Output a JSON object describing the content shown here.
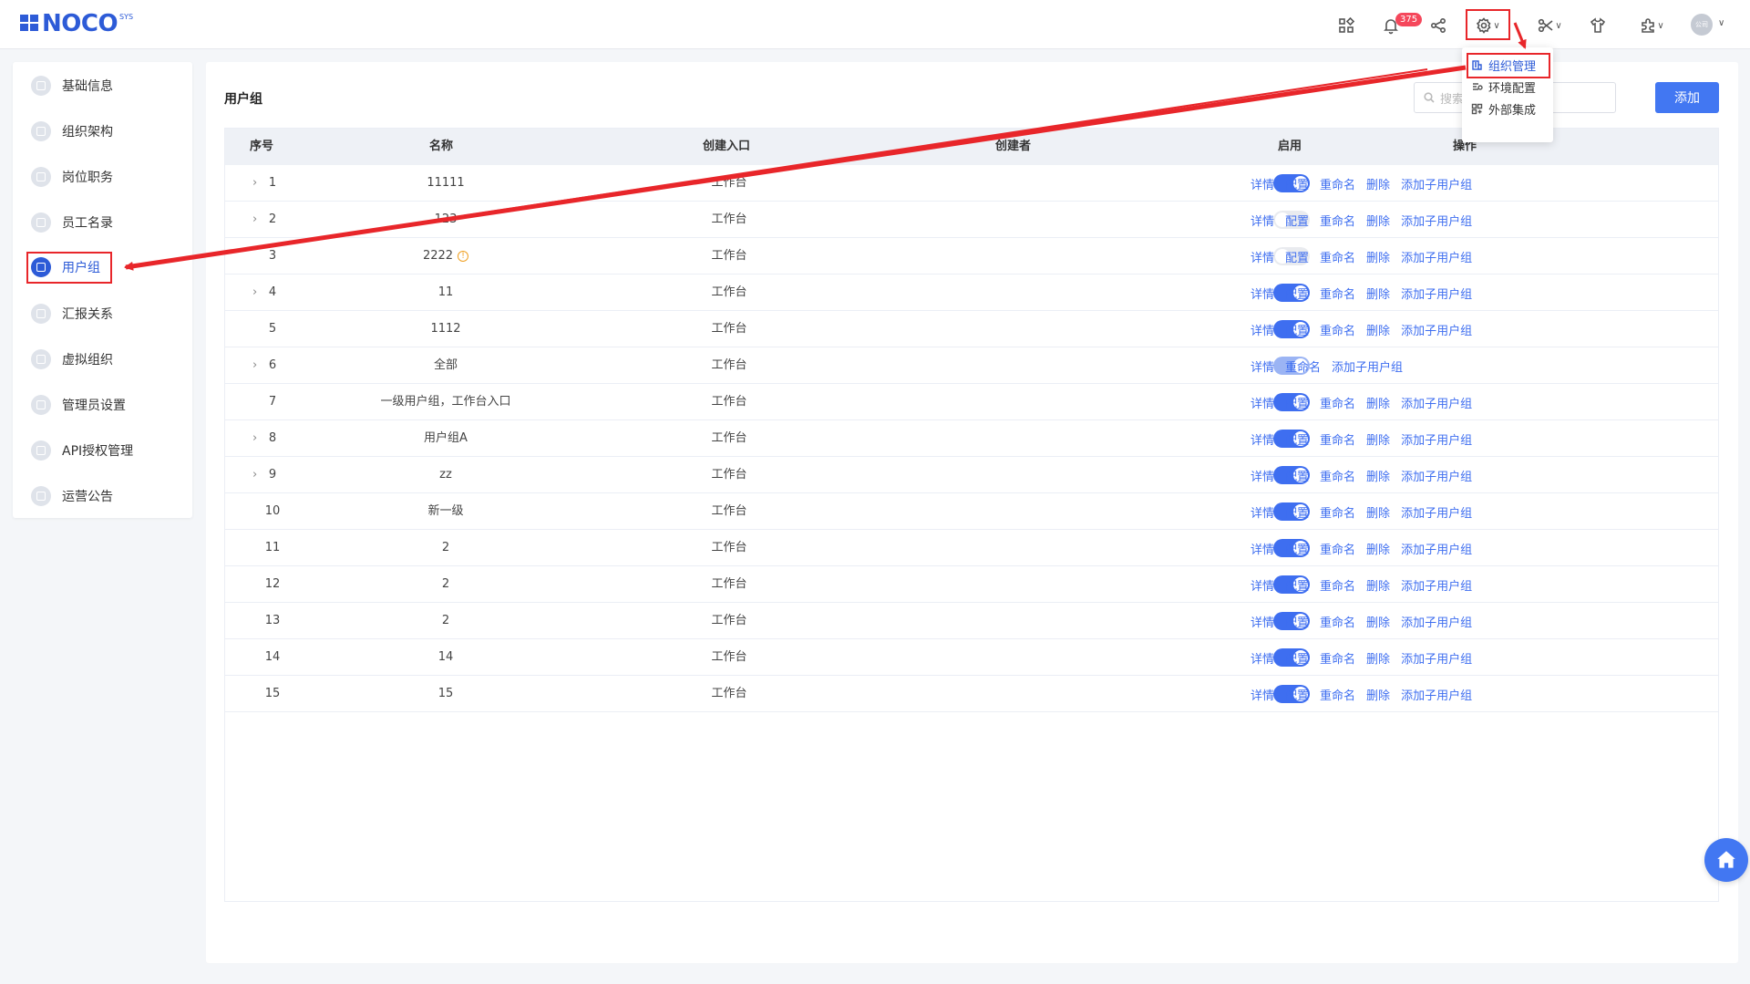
{
  "app": {
    "logo_text": "NOCO",
    "logo_sup": "SYS"
  },
  "header": {
    "notification_count": "375",
    "avatar_text": "公司"
  },
  "settings_menu": {
    "items": [
      {
        "label": "组织管理",
        "icon": "org-icon",
        "active": true
      },
      {
        "label": "环境配置",
        "icon": "env-icon",
        "active": false
      },
      {
        "label": "外部集成",
        "icon": "integration-icon",
        "active": false
      }
    ]
  },
  "sidebar": {
    "items": [
      {
        "label": "基础信息"
      },
      {
        "label": "组织架构"
      },
      {
        "label": "岗位职务"
      },
      {
        "label": "员工名录"
      },
      {
        "label": "用户组",
        "active": true
      },
      {
        "label": "汇报关系"
      },
      {
        "label": "虚拟组织"
      },
      {
        "label": "管理员设置"
      },
      {
        "label": "API授权管理"
      },
      {
        "label": "运营公告"
      }
    ]
  },
  "main": {
    "title": "用户组",
    "search_placeholder": "搜索",
    "add_label": "添加",
    "columns": [
      "序号",
      "名称",
      "创建入口",
      "创建者",
      "启用",
      "操作"
    ],
    "op_labels": {
      "detail": "详情",
      "config": "配置",
      "rename": "重命名",
      "delete": "删除",
      "add_child": "添加子用户组"
    },
    "rows": [
      {
        "no": "1",
        "name": "11111",
        "entry": "工作台",
        "expandable": true,
        "enabled": true,
        "ops": "full"
      },
      {
        "no": "2",
        "name": "123",
        "entry": "工作台",
        "expandable": true,
        "enabled": false,
        "ops": "full"
      },
      {
        "no": "3",
        "name": "2222",
        "entry": "工作台",
        "expandable": false,
        "enabled": false,
        "warn": true,
        "ops": "full"
      },
      {
        "no": "4",
        "name": "11",
        "entry": "工作台",
        "expandable": true,
        "enabled": true,
        "ops": "full"
      },
      {
        "no": "5",
        "name": "1112",
        "entry": "工作台",
        "expandable": false,
        "enabled": true,
        "ops": "full"
      },
      {
        "no": "6",
        "name": "全部",
        "entry": "工作台",
        "expandable": true,
        "enabled": true,
        "dim": true,
        "ops": "short"
      },
      {
        "no": "7",
        "name": "一级用户组，工作台入口",
        "entry": "工作台",
        "expandable": false,
        "enabled": true,
        "ops": "full"
      },
      {
        "no": "8",
        "name": "用户组A",
        "entry": "工作台",
        "expandable": true,
        "enabled": true,
        "ops": "full"
      },
      {
        "no": "9",
        "name": "zz",
        "entry": "工作台",
        "expandable": true,
        "enabled": true,
        "ops": "full"
      },
      {
        "no": "10",
        "name": "新一级",
        "entry": "工作台",
        "expandable": false,
        "enabled": true,
        "ops": "full"
      },
      {
        "no": "11",
        "name": "2",
        "entry": "工作台",
        "expandable": false,
        "enabled": true,
        "ops": "full"
      },
      {
        "no": "12",
        "name": "2",
        "entry": "工作台",
        "expandable": false,
        "enabled": true,
        "ops": "full"
      },
      {
        "no": "13",
        "name": "2",
        "entry": "工作台",
        "expandable": false,
        "enabled": true,
        "ops": "full"
      },
      {
        "no": "14",
        "name": "14",
        "entry": "工作台",
        "expandable": false,
        "enabled": true,
        "ops": "full"
      },
      {
        "no": "15",
        "name": "15",
        "entry": "工作台",
        "expandable": false,
        "enabled": true,
        "ops": "full"
      }
    ]
  },
  "colors": {
    "accent": "#2d5bd7",
    "button": "#4277f2",
    "annotation": "#e8262a"
  }
}
